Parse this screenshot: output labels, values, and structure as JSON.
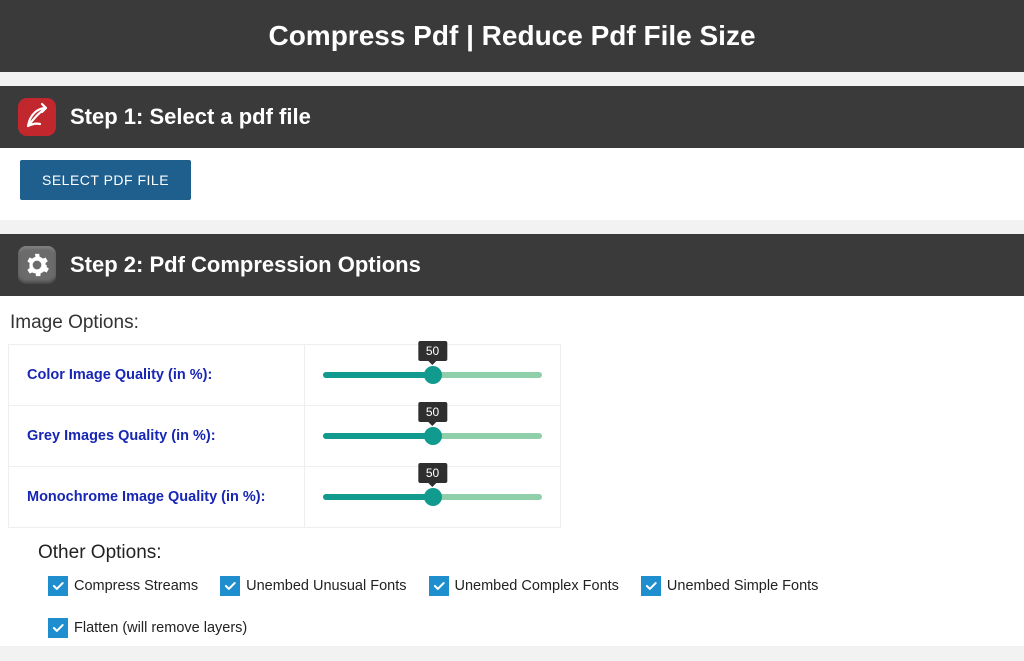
{
  "title": "Compress Pdf | Reduce Pdf File Size",
  "step1": {
    "heading": "Step 1: Select a pdf file",
    "button": "SELECT PDF FILE"
  },
  "step2": {
    "heading": "Step 2: Pdf Compression Options"
  },
  "imageOptions": {
    "heading": "Image Options:",
    "sliders": [
      {
        "label": "Color Image Quality (in %):",
        "value": 50
      },
      {
        "label": "Grey Images Quality (in %):",
        "value": 50
      },
      {
        "label": "Monochrome Image Quality (in %):",
        "value": 50
      }
    ]
  },
  "otherOptions": {
    "heading": "Other Options:",
    "checks": [
      {
        "label": "Compress Streams",
        "checked": true
      },
      {
        "label": "Unembed Unusual Fonts",
        "checked": true
      },
      {
        "label": "Unembed Complex Fonts",
        "checked": true
      },
      {
        "label": "Unembed Simple Fonts",
        "checked": true
      },
      {
        "label": "Flatten (will remove layers)",
        "checked": true
      }
    ]
  }
}
